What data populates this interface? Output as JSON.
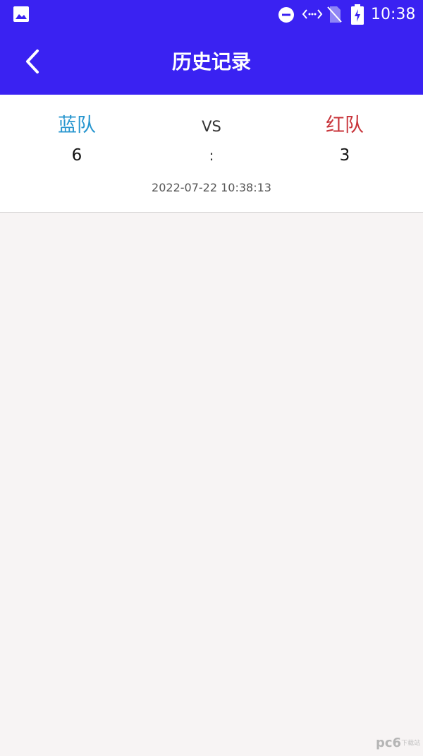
{
  "status_bar": {
    "time": "10:38",
    "icons": [
      "image-icon",
      "do-not-disturb-icon",
      "data-transfer-icon",
      "no-sim-icon",
      "battery-charging-icon"
    ]
  },
  "app_bar": {
    "title": "历史记录",
    "back_icon": "chevron-left-icon"
  },
  "record": {
    "team_a": {
      "name": "蓝队",
      "score": "6",
      "color": "#2896cf"
    },
    "vs": "VS",
    "separator": ":",
    "team_b": {
      "name": "红队",
      "score": "3",
      "color": "#c8343a"
    },
    "time": "2022-07-22 10:38:13"
  },
  "watermark": {
    "brand": "pc6",
    "sub": "下载站"
  },
  "colors": {
    "primary": "#3a22f2",
    "background": "#f7f4f4",
    "card": "#ffffff"
  }
}
